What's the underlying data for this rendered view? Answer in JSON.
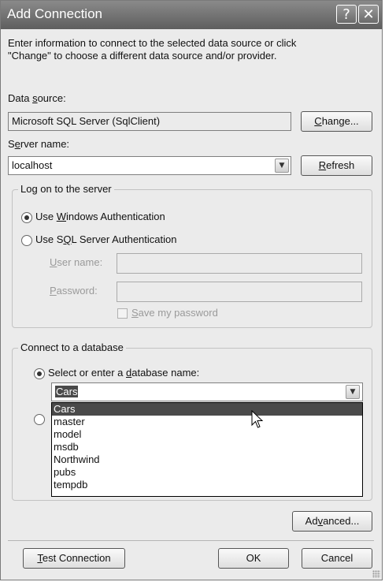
{
  "window": {
    "title": "Add Connection",
    "help_glyph": "?",
    "close_glyph": "✕"
  },
  "intro": {
    "line1": "Enter information to connect to the selected data source or click",
    "line2": "\"Change\" to choose a different data source and/or provider."
  },
  "data_source": {
    "label_pre": "Data ",
    "label_key": "s",
    "label_post": "ource:",
    "value": "Microsoft SQL Server (SqlClient)",
    "change_key": "C",
    "change_rest": "hange..."
  },
  "server": {
    "label_pre": "S",
    "label_key": "e",
    "label_post": "rver name:",
    "value": "localhost",
    "refresh_key": "R",
    "refresh_rest": "efresh"
  },
  "logon": {
    "legend": "Log on to the server",
    "windows_auth_pre": "Use ",
    "windows_auth_key": "W",
    "windows_auth_post": "indows Authentication",
    "sql_auth_pre": "Use S",
    "sql_auth_key": "Q",
    "sql_auth_post": "L Server Authentication",
    "username_key": "U",
    "username_rest": "ser name:",
    "password_key": "P",
    "password_rest": "assword:",
    "save_password_key": "S",
    "save_password_rest": "ave my password",
    "selected": "windows"
  },
  "database": {
    "legend": "Connect to a database",
    "select_pre": "Select or enter a ",
    "select_key": "d",
    "select_post": "atabase name:",
    "value": "Cars",
    "options": [
      "Cars",
      "master",
      "model",
      "msdb",
      "Northwind",
      "pubs",
      "tempdb"
    ],
    "highlighted_index": 0
  },
  "buttons": {
    "advanced_pre": "Ad",
    "advanced_key": "v",
    "advanced_post": "anced...",
    "test_key": "T",
    "test_rest": "est Connection",
    "ok": "OK",
    "cancel": "Cancel"
  },
  "colors": {
    "titlebar": "#6e6e6e",
    "dialog_bg": "#ebebeb",
    "selection": "#4a4a4a"
  }
}
